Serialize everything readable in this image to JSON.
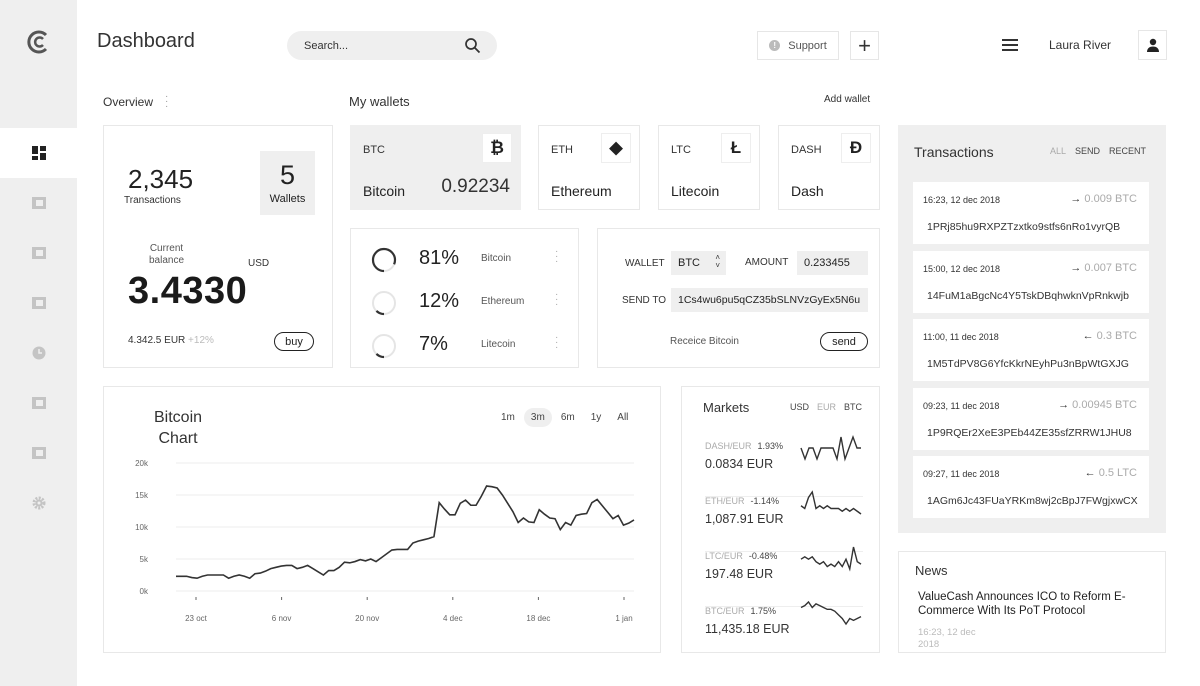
{
  "header": {
    "title": "Dashboard",
    "search_placeholder": "Search...",
    "support_label": "Support",
    "user_name": "Laura River"
  },
  "sidebar": {
    "items": [
      {
        "icon": "dashboard-icon",
        "active": true
      },
      {
        "icon": "wallet-icon"
      },
      {
        "icon": "bar-chart-icon"
      },
      {
        "icon": "calendar-icon"
      },
      {
        "icon": "clock-icon"
      },
      {
        "icon": "table-icon"
      },
      {
        "icon": "document-icon"
      },
      {
        "icon": "gear-icon"
      }
    ]
  },
  "overview": {
    "label": "Overview",
    "transactions_value": "2,345",
    "transactions_label": "Transactions",
    "wallets_value": "5",
    "wallets_label": "Wallets",
    "balance_label_1": "Current",
    "balance_label_2": "balance",
    "currency": "USD",
    "balance": "3.4330",
    "eur": "4.342.5 EUR",
    "change": "+12%",
    "buy_label": "buy"
  },
  "wallets": {
    "label": "My wallets",
    "add_label": "Add wallet",
    "items": [
      {
        "code": "BTC",
        "name": "Bitcoin",
        "amount": "0.92234",
        "icon": "bitcoin-icon",
        "glyph": "₿"
      },
      {
        "code": "ETH",
        "name": "Ethereum",
        "icon": "ethereum-icon",
        "glyph": "◆"
      },
      {
        "code": "LTC",
        "name": "Litecoin",
        "icon": "litecoin-icon",
        "glyph": "Ł"
      },
      {
        "code": "DASH",
        "name": "Dash",
        "icon": "dash-icon",
        "glyph": "Đ"
      }
    ]
  },
  "portfolio": [
    {
      "percent": "81%",
      "value": 81,
      "name": "Bitcoin"
    },
    {
      "percent": "12%",
      "value": 12,
      "name": "Ethereum"
    },
    {
      "percent": "7%",
      "value": 7,
      "name": "Litecoin"
    }
  ],
  "send": {
    "wallet_label": "WALLET",
    "wallet_value": "BTC",
    "amount_label": "AMOUNT",
    "amount_value": "0.233455",
    "sendto_label": "SEND TO",
    "sendto_value": "1Cs4wu6pu5qCZ35bSLNVzGyEx5N6u",
    "receive_label": "Receice Bitcoin",
    "send_label": "send"
  },
  "chart_data": {
    "type": "line",
    "title_1": "Bitcoin",
    "title_2": "Chart",
    "ranges": [
      "1m",
      "3m",
      "6m",
      "1y",
      "All"
    ],
    "selected_range": "3m",
    "yticks": [
      "20k",
      "15k",
      "10k",
      "5k",
      "0k"
    ],
    "ylim": [
      0,
      20000
    ],
    "xticks": [
      "23 oct",
      "6 nov",
      "20 nov",
      "4 dec",
      "18 dec",
      "1 jan"
    ],
    "grid": true,
    "values": [
      2300,
      2300,
      2300,
      2100,
      2000,
      2300,
      2500,
      2500,
      2500,
      2500,
      2000,
      2300,
      2500,
      2300,
      2000,
      2700,
      2800,
      3100,
      3500,
      3700,
      3900,
      4000,
      4000,
      3500,
      3700,
      4000,
      3500,
      3000,
      2500,
      3200,
      3200,
      3700,
      4500,
      4400,
      4600,
      4900,
      4700,
      5000,
      4600,
      5200,
      5800,
      6400,
      6500,
      6500,
      6500,
      7500,
      7800,
      8000,
      8200,
      8500,
      13800,
      12800,
      11900,
      11900,
      13700,
      14200,
      13400,
      13400,
      14800,
      16400,
      16300,
      16100,
      15000,
      13700,
      12400,
      10700,
      11400,
      10800,
      10700,
      12700,
      12000,
      11400,
      11300,
      9600,
      10700,
      10300,
      11800,
      12000,
      12100,
      13800,
      14300,
      13300,
      12300,
      11300,
      11800,
      10300,
      10600,
      11100
    ]
  },
  "markets": {
    "title": "Markets",
    "currencies": [
      "USD",
      "EUR",
      "BTC"
    ],
    "items": [
      {
        "pair": "DASH/EUR",
        "change": "1.93%",
        "value": "0.0834  EUR",
        "spark": [
          5,
          6,
          5,
          5,
          6,
          5,
          5,
          5,
          5,
          6,
          4,
          6,
          5,
          4,
          5,
          5
        ]
      },
      {
        "pair": "ETH/EUR",
        "change": "-1.14%",
        "value": "1,087.91  EUR",
        "spark": [
          5,
          6,
          2,
          0,
          6,
          5,
          6,
          5,
          6,
          6,
          6,
          7,
          6,
          7,
          6,
          7,
          8
        ]
      },
      {
        "pair": "LTC/EUR",
        "change": "-0.48%",
        "value": "197.48  EUR",
        "spark": [
          6,
          5,
          6,
          5,
          7,
          8,
          7,
          9,
          8,
          9,
          7,
          9,
          6,
          10,
          1,
          7,
          8
        ]
      },
      {
        "pair": "BTC/EUR",
        "change": "1.75%",
        "value": "11,435.18 EUR",
        "spark": [
          3,
          2,
          0,
          3,
          1,
          2,
          3,
          4,
          4,
          5,
          7,
          9,
          12,
          9,
          10,
          9,
          8
        ]
      }
    ]
  },
  "transactions": {
    "title": "Transactions",
    "filters": [
      "ALL",
      "SEND",
      "RECENT"
    ],
    "items": [
      {
        "date": "16:23, 12 dec 2018",
        "dir": "→",
        "amount": "0.009 BTC",
        "hash": "1PRj85hu9RXPZTzxtko9stfs6nRo1vyrQB"
      },
      {
        "date": "15:00, 12 dec 2018",
        "dir": "→",
        "amount": "0.007 BTC",
        "hash": "14FuM1aBgcNc4Y5TskDBqhwknVpRnkwjb"
      },
      {
        "date": "11:00, 11 dec 2018",
        "dir": "←",
        "amount": "0.3 BTC",
        "hash": "1M5TdPV8G6YfcKkrNEyhPu3nBpWtGXJG"
      },
      {
        "date": "09:23, 11 dec 2018",
        "dir": "→",
        "amount": "0.00945 BTC",
        "hash": "1P9RQEr2XeE3PEb44ZE35sfZRRW1JHU8"
      },
      {
        "date": "09:27, 11 dec 2018",
        "dir": "←",
        "amount": "0.5 LTC",
        "hash": "1AGm6Jc43FUaYRKm8wj2cBpJ7FWgjxwCX"
      }
    ]
  },
  "news": {
    "title": "News",
    "headline": "ValueCash Announces ICO to Reform E-Commerce With Its PoT Protocol",
    "date_1": "16:23, 12 dec",
    "date_2": "2018"
  }
}
